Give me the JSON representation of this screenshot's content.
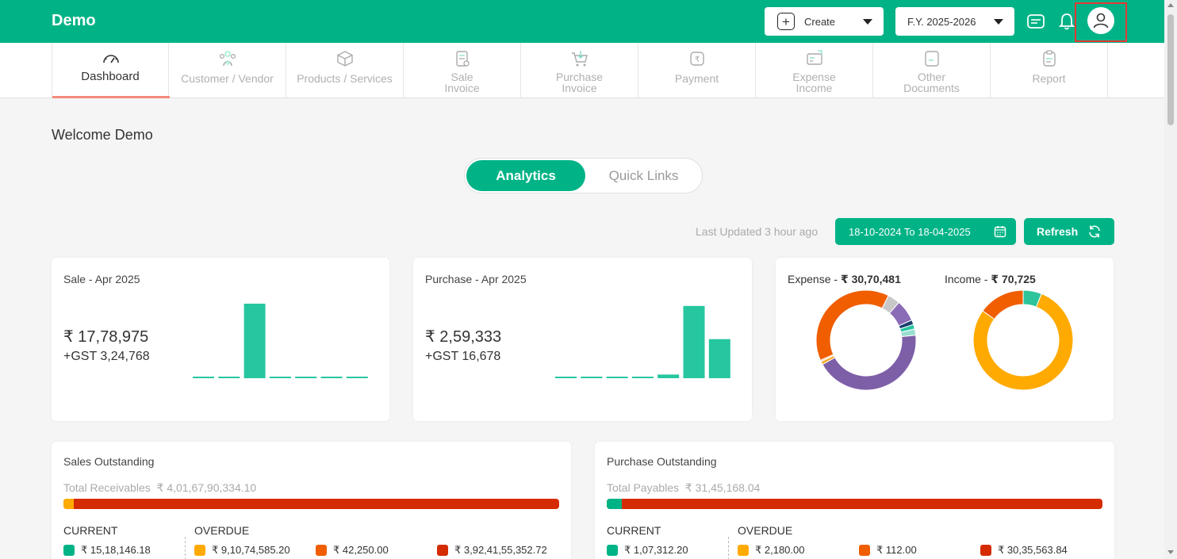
{
  "app": {
    "brand": "Demo"
  },
  "topbar": {
    "create_label": "Create",
    "fy_label": "F.Y. 2025-2026",
    "icons": [
      "chat-icon",
      "bell-icon",
      "user-icon"
    ]
  },
  "nav": {
    "items": [
      {
        "label1": "Dashboard",
        "label2": "",
        "icon": "speedometer-icon",
        "active": true
      },
      {
        "label1": "Customer / Vendor",
        "label2": "",
        "icon": "people-icon"
      },
      {
        "label1": "Products / Services",
        "label2": "",
        "icon": "box-icon"
      },
      {
        "label1": "Sale",
        "label2": "Invoice",
        "icon": "invoice-icon"
      },
      {
        "label1": "Purchase",
        "label2": "Invoice",
        "icon": "cart-icon"
      },
      {
        "label1": "Payment",
        "label2": "",
        "icon": "payment-icon"
      },
      {
        "label1": "Expense",
        "label2": "Income",
        "icon": "expense-icon"
      },
      {
        "label1": "Other",
        "label2": "Documents",
        "icon": "document-icon"
      },
      {
        "label1": "Report",
        "label2": "",
        "icon": "clipboard-icon"
      }
    ]
  },
  "welcome": "Welcome Demo",
  "toggle": {
    "analytics": "Analytics",
    "quick_links": "Quick Links"
  },
  "toolbar": {
    "last_updated": "Last Updated 3 hour ago",
    "date_range": "18-10-2024 To 18-04-2025",
    "refresh": "Refresh"
  },
  "sale_card": {
    "title": "Sale - Apr 2025",
    "amount": "₹ 17,78,975",
    "gst": "+GST 3,24,768",
    "bar_values": [
      0.02,
      0.02,
      1.0,
      0.02,
      0.02,
      0.005,
      0.02
    ]
  },
  "purchase_card": {
    "title": "Purchase - Apr 2025",
    "amount": "₹ 2,59,333",
    "gst": "+GST 16,678",
    "bar_values": [
      0.02,
      0.02,
      0.02,
      0.02,
      0.05,
      0.98,
      0.53
    ]
  },
  "expense_income": {
    "expense_label": "Expense - ",
    "expense_value": "₹ 30,70,481",
    "income_label": "Income - ",
    "income_value": "₹ 70,725",
    "expense_slices": [
      {
        "value": 0.435,
        "color": "#7d5fa8"
      },
      {
        "value": 0.01,
        "color": "#f5a623"
      },
      {
        "value": 0.005,
        "color": "#f0c9a0"
      },
      {
        "value": 0.39,
        "color": "#f05e00"
      },
      {
        "value": 0.04,
        "color": "#c8c8c8"
      },
      {
        "value": 0.07,
        "color": "#8a6bb5"
      },
      {
        "value": 0.015,
        "color": "#1c3f6e"
      },
      {
        "value": 0.015,
        "color": "#26c6a0"
      },
      {
        "value": 0.02,
        "color": "#9adfd0"
      }
    ],
    "income_slices": [
      {
        "value": 0.06,
        "color": "#2ec49a"
      },
      {
        "value": 0.79,
        "color": "#ffaa00"
      },
      {
        "value": 0.15,
        "color": "#f05e00"
      }
    ]
  },
  "sales_outstanding": {
    "title": "Sales Outstanding",
    "total_label": "Total Receivables",
    "total_value": "₹ 4,01,67,90,334.10",
    "current_fraction": 0.02,
    "current_color": "#ffaa00",
    "current_head": "CURRENT",
    "overdue_head": "OVERDUE",
    "current_value": "₹ 15,18,146.18",
    "overdue": [
      {
        "value": "₹ 9,10,74,585.20",
        "color": "#ffaa00"
      },
      {
        "value": "₹ 42,250.00",
        "color": "#f05e00"
      },
      {
        "value": "₹ 3,92,41,55,352.72",
        "color": "#d52b00"
      }
    ]
  },
  "purchase_outstanding": {
    "title": "Purchase Outstanding",
    "total_label": "Total Payables",
    "total_value": "₹ 31,45,168.04",
    "current_fraction": 0.03,
    "current_color": "#00b386",
    "current_head": "CURRENT",
    "overdue_head": "OVERDUE",
    "current_value": "₹ 1,07,312.20",
    "overdue": [
      {
        "value": "₹ 2,180.00",
        "color": "#ffaa00"
      },
      {
        "value": "₹ 112.00",
        "color": "#f05e00"
      },
      {
        "value": "₹ 30,35,563.84",
        "color": "#d52b00"
      }
    ]
  },
  "colors": {
    "brand": "#00b386",
    "bar": "#26c6a0",
    "current_sq": "#00b386"
  }
}
